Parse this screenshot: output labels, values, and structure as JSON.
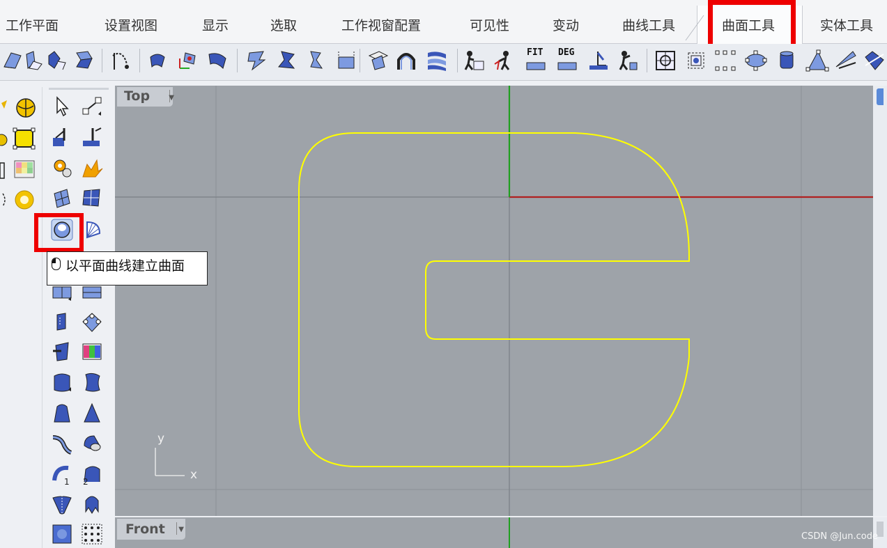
{
  "tabs": [
    {
      "label": "工作平面"
    },
    {
      "label": "设置视图"
    },
    {
      "label": "显示"
    },
    {
      "label": "选取"
    },
    {
      "label": "工作视窗配置"
    },
    {
      "label": "可见性"
    },
    {
      "label": "变动"
    },
    {
      "label": "曲线工具"
    },
    {
      "label": "曲面工具",
      "active": true
    },
    {
      "label": "实体工具"
    }
  ],
  "toolbar": {
    "fit_label": "FIT",
    "deg_label": "DEG",
    "icons": [
      "rebuild-icon",
      "fillet-surface-icon",
      "blend-icon",
      "match-icon",
      "dir-icon",
      "offset-icon",
      "split-icon",
      "trim-icon",
      "extend-icon",
      "merge-icon",
      "unroll-icon",
      "flow-icon",
      "network-icon",
      "loft-icon",
      "sweep-icon",
      "rail-icon",
      "patch-icon",
      "fit-icon",
      "degree-icon",
      "extract-icon",
      "move-uvn-icon",
      "point-on-icon",
      "points-icon",
      "control-points-icon",
      "cage-icon",
      "flow-along-icon",
      "shear-icon",
      "twist-icon",
      "more-icon"
    ]
  },
  "tooltip": {
    "text": "以平面曲线建立曲面",
    "icon": "mouse-left-icon"
  },
  "viewport_top": {
    "label": "Top",
    "axis_x": "x",
    "axis_y": "y",
    "curve_color": "#ffff00",
    "x_axis_color": "#b02020",
    "y_axis_color": "#20a020"
  },
  "viewport_front": {
    "label": "Front"
  },
  "watermark": "CSDN @Jun.code",
  "highlight_color": "#ee0000"
}
